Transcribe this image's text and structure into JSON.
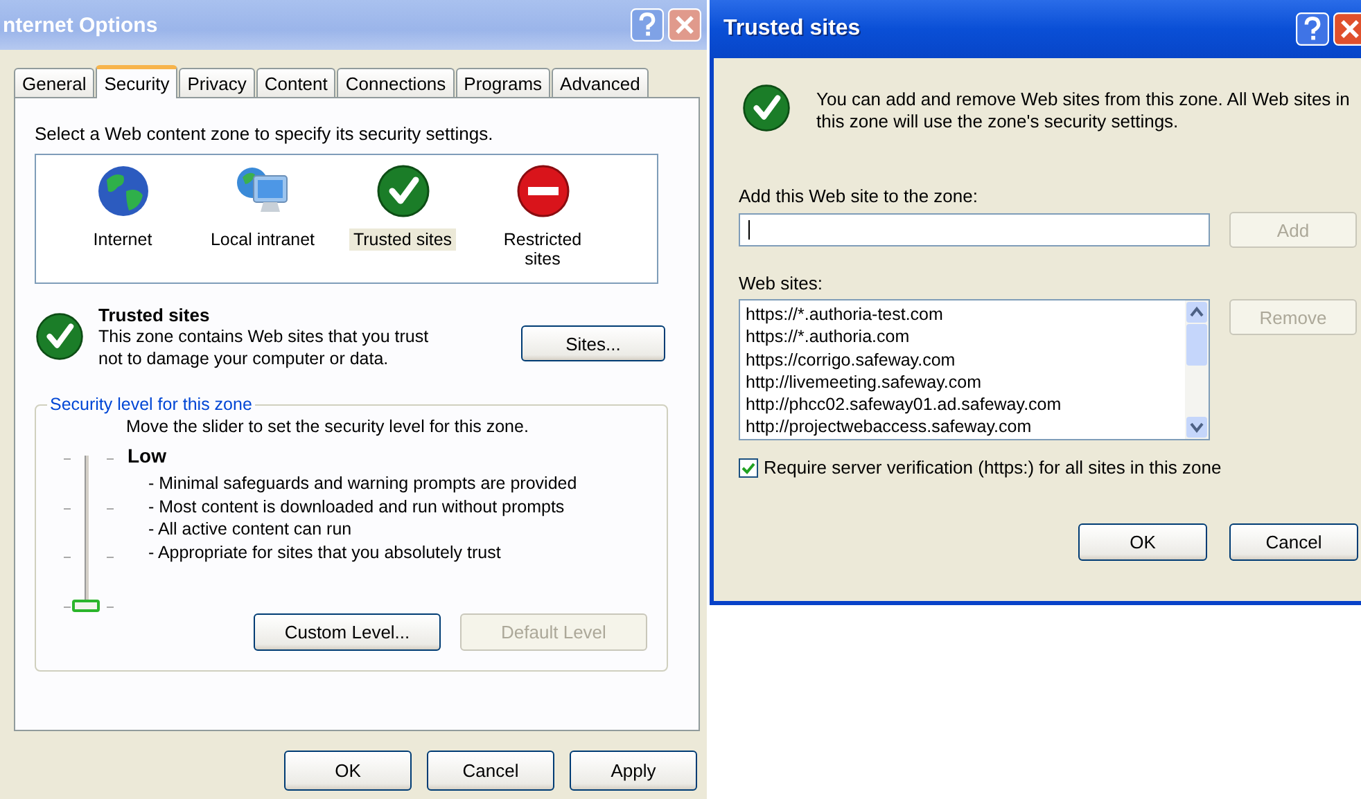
{
  "internet_options": {
    "title": "nternet Options",
    "tabs": [
      {
        "label": "General",
        "selected": false
      },
      {
        "label": "Security",
        "selected": true
      },
      {
        "label": "Privacy",
        "selected": false
      },
      {
        "label": "Content",
        "selected": false
      },
      {
        "label": "Connections",
        "selected": false
      },
      {
        "label": "Programs",
        "selected": false
      },
      {
        "label": "Advanced",
        "selected": false
      }
    ],
    "zone_prompt": "Select a Web content zone to specify its security settings.",
    "zones": [
      {
        "kind": "globe",
        "label": "Internet",
        "selected": false
      },
      {
        "kind": "intranet",
        "label": "Local intranet",
        "selected": false
      },
      {
        "kind": "trusted",
        "label": "Trusted sites",
        "selected": true
      },
      {
        "kind": "restricted",
        "label": "Restricted sites",
        "selected": false
      }
    ],
    "zone_info": {
      "title": "Trusted sites",
      "description": "This zone contains Web sites that you trust not to damage your computer or data.",
      "button": {
        "label": "Sites...",
        "disabled": false
      }
    },
    "security_level": {
      "legend": "Security level for this zone",
      "hint": "Move the slider to set the security level for this zone.",
      "slider": {
        "level": 0
      },
      "level_name": "Low",
      "bullets": [
        "- Minimal safeguards and warning prompts are provided",
        "- Most content is downloaded and run without prompts",
        "- All active content can run",
        "- Appropriate for sites that you absolutely trust"
      ],
      "buttons": [
        {
          "label": "Custom Level...",
          "disabled": false
        },
        {
          "label": "Default Level",
          "disabled": true
        }
      ]
    },
    "buttons": [
      {
        "label": "OK",
        "disabled": false
      },
      {
        "label": "Cancel",
        "disabled": false
      },
      {
        "label": "Apply",
        "disabled": false
      }
    ]
  },
  "trusted_sites": {
    "title": "Trusted sites",
    "intro": "You can add and remove Web sites from this zone. All Web sites in this zone will use the zone's security settings.",
    "add_label": "Add this Web site to the zone:",
    "add_button": {
      "label": "Add",
      "disabled": true
    },
    "list_label": "Web sites:",
    "sites": [
      "https://*.authoria-test.com",
      "https://*.authoria.com",
      "https://corrigo.safeway.com",
      "http://livemeeting.safeway.com",
      "http://phcc02.safeway01.ad.safeway.com",
      "http://projectwebaccess.safeway.com"
    ],
    "remove_button": {
      "label": "Remove",
      "disabled": true
    },
    "require_verification": {
      "label": "Require server verification (https:) for all sites in this zone",
      "checked": true
    },
    "buttons": [
      {
        "label": "OK",
        "disabled": false
      },
      {
        "label": "Cancel",
        "disabled": false
      }
    ]
  }
}
